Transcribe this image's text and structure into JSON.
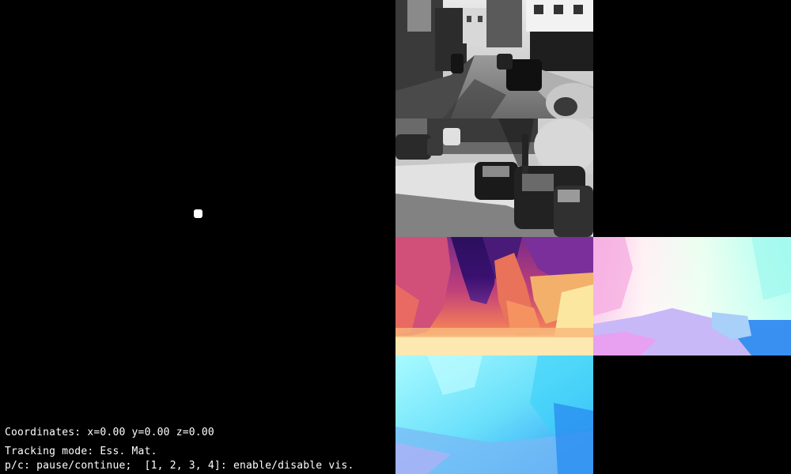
{
  "hud": {
    "coordinates_text": "Coordinates: x=0.00 y=0.00 z=0.00",
    "tracking_mode_text": "Tracking mode: Ess. Mat.",
    "help_text": "p/c: pause/continue;  [1, 2, 3, 4]: enable/disable vis."
  },
  "colors": {
    "background": "#000000",
    "hud_text": "#ffffff",
    "trajectory_dot": "#ffffff"
  },
  "views": [
    {
      "name": "grayscale-frame-current",
      "kind": "grayscale street image"
    },
    {
      "name": "grayscale-frame-zoom",
      "kind": "grayscale street image"
    },
    {
      "name": "depth-map",
      "kind": "magma colormap depth"
    },
    {
      "name": "optical-flow-1",
      "kind": "flow color wheel"
    },
    {
      "name": "optical-flow-2",
      "kind": "flow color wheel"
    }
  ]
}
